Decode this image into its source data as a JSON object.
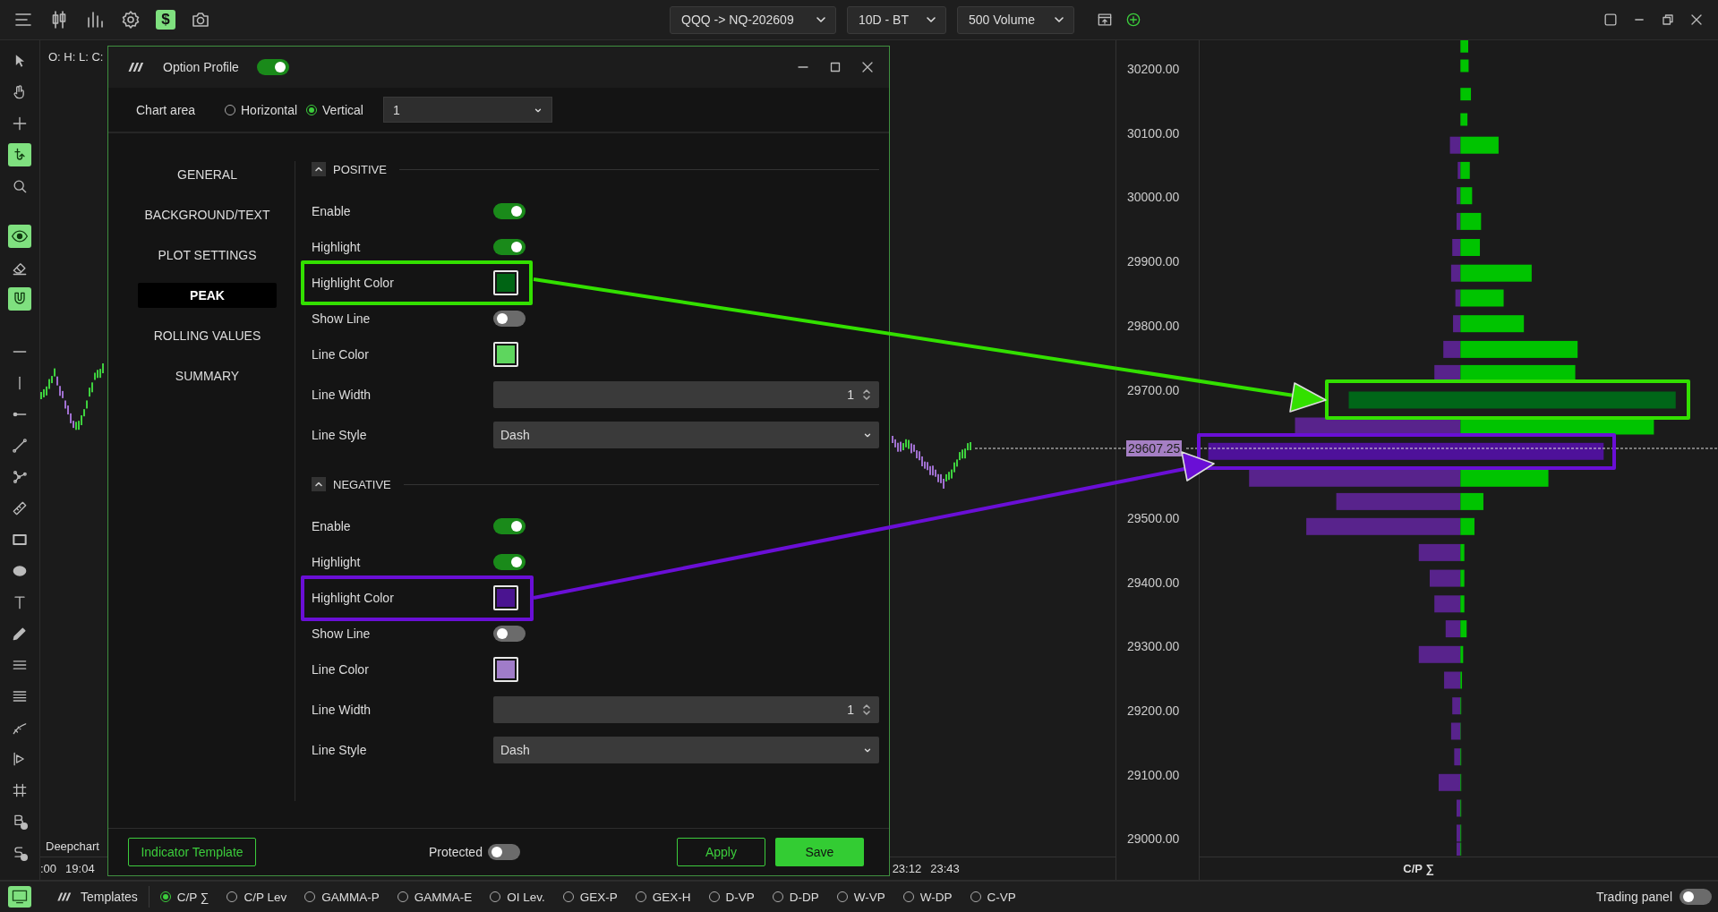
{
  "top_bar": {
    "dollar_button": "$",
    "dropdowns": [
      "QQQ -> NQ-202609",
      "10D - BT",
      "500 Volume"
    ]
  },
  "tool_groups": [
    [
      {
        "active": false
      },
      {
        "active": false
      },
      {
        "active": false
      },
      {
        "active": true
      },
      {
        "active": false
      }
    ],
    [
      {
        "active": true
      },
      {
        "active": false
      },
      {
        "active": true
      }
    ],
    [
      {
        "active": false
      },
      {
        "active": false
      },
      {
        "active": false
      },
      {
        "active": false
      },
      {
        "active": false
      },
      {
        "active": false
      },
      {
        "active": false
      },
      {
        "active": false
      },
      {
        "active": false
      },
      {
        "active": false
      },
      {
        "active": false
      },
      {
        "active": false
      },
      {
        "active": false
      },
      {
        "active": false
      },
      {
        "active": false
      },
      {
        "active": false
      },
      {
        "active": false
      }
    ]
  ],
  "chart": {
    "ohlc_label": "O: H: L: C:",
    "study_label": "Deepchart",
    "time_labels_left": [
      ":00",
      "19:04"
    ],
    "time_labels_right": [
      "23:12",
      "23:43"
    ]
  },
  "price_axis": {
    "labels_above": [
      "30200.00",
      "30100.00",
      "30000.00",
      "29900.00",
      "29800.00",
      "29700.00"
    ],
    "current_price": "29607.25",
    "labels_below": [
      "29500.00",
      "29400.00",
      "29300.00",
      "29200.00",
      "29100.00",
      "29000.00"
    ]
  },
  "profile": {
    "title": "C/P ∑"
  },
  "dialog": {
    "title": "Option Profile",
    "enabled": true,
    "chart_area": {
      "label": "Chart area",
      "options": [
        {
          "label": "Horizontal",
          "selected": false
        },
        {
          "label": "Vertical",
          "selected": true
        }
      ],
      "pane": "1"
    },
    "nav": [
      {
        "label": "GENERAL",
        "selected": false
      },
      {
        "label": "BACKGROUND/TEXT",
        "selected": false
      },
      {
        "label": "PLOT SETTINGS",
        "selected": false
      },
      {
        "label": "PEAK",
        "selected": true
      },
      {
        "label": "ROLLING VALUES",
        "selected": false
      },
      {
        "label": "SUMMARY",
        "selected": false
      }
    ],
    "sections": [
      {
        "title": "POSITIVE",
        "expanded": true,
        "rows": [
          {
            "kind": "toggle",
            "label": "Enable",
            "on": true
          },
          {
            "kind": "toggle",
            "label": "Highlight",
            "on": true
          },
          {
            "kind": "color",
            "label": "Highlight Color",
            "color": "#006414"
          },
          {
            "kind": "toggle",
            "label": "Show Line",
            "on": false
          },
          {
            "kind": "color",
            "label": "Line Color",
            "color": "#5ed65e"
          },
          {
            "kind": "number",
            "label": "Line Width",
            "value": "1"
          },
          {
            "kind": "select",
            "label": "Line Style",
            "value": "Dash"
          }
        ]
      },
      {
        "title": "NEGATIVE",
        "expanded": true,
        "rows": [
          {
            "kind": "toggle",
            "label": "Enable",
            "on": true
          },
          {
            "kind": "toggle",
            "label": "Highlight",
            "on": true
          },
          {
            "kind": "color",
            "label": "Highlight Color",
            "color": "#4a1490"
          },
          {
            "kind": "toggle",
            "label": "Show Line",
            "on": false
          },
          {
            "kind": "color",
            "label": "Line Color",
            "color": "#a07cc8"
          },
          {
            "kind": "number",
            "label": "Line Width",
            "value": "1"
          },
          {
            "kind": "select",
            "label": "Line Style",
            "value": "Dash"
          }
        ]
      }
    ],
    "footer": {
      "template_button": "Indicator Template",
      "protected_label": "Protected",
      "protected": false,
      "apply_button": "Apply",
      "save_button": "Save"
    }
  },
  "bottom_bar": {
    "layout_active": true,
    "templates_label": "Templates",
    "templates": [
      {
        "label": "C/P ∑",
        "selected": true
      },
      {
        "label": "C/P Lev",
        "selected": false
      },
      {
        "label": "GAMMA-P",
        "selected": false
      },
      {
        "label": "GAMMA-E",
        "selected": false
      },
      {
        "label": "OI Lev.",
        "selected": false
      },
      {
        "label": "GEX-P",
        "selected": false
      },
      {
        "label": "GEX-H",
        "selected": false
      },
      {
        "label": "D-VP",
        "selected": false
      },
      {
        "label": "D-DP",
        "selected": false
      },
      {
        "label": "W-VP",
        "selected": false
      },
      {
        "label": "W-DP",
        "selected": false
      },
      {
        "label": "C-VP",
        "selected": false
      }
    ],
    "trading_panel_label": "Trading panel",
    "trading_panel": false
  }
}
